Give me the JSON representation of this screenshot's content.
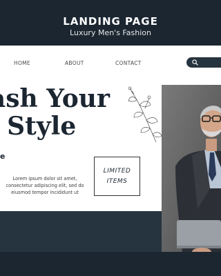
{
  "banner": {
    "title": "LANDING PAGE",
    "subtitle": "Luxury Men's Fashion"
  },
  "nav": {
    "items": [
      "HOME",
      "ABOUT",
      "CONTACT"
    ],
    "search_icon": "search-icon"
  },
  "hero": {
    "headline_line1": "eash Your",
    "headline_line2": "ic Style",
    "fragment": "e",
    "body_lines": [
      "Lorem ipsum dolor sit amet,",
      "consectetur adipiscing elit, sed do",
      "eiusmod tempor incididunt ut"
    ],
    "box_line1": "LIMITED",
    "box_line2": "ITEMS"
  },
  "colors": {
    "dark_navy": "#1b2631",
    "band_navy": "#26343f",
    "white": "#ffffff"
  }
}
